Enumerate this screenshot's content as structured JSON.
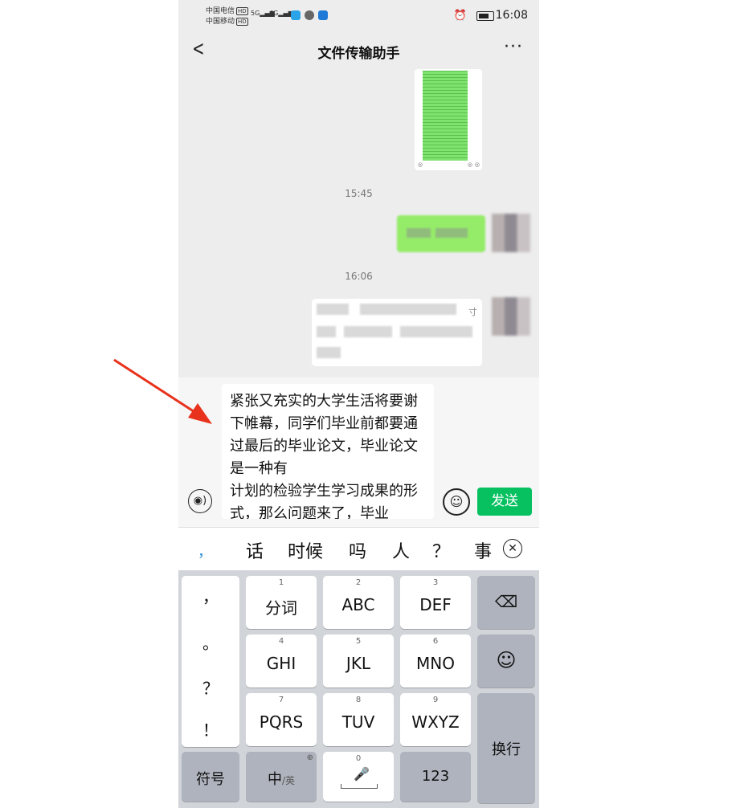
{
  "status_bar": {
    "carrier1": "中国电信",
    "carrier2": "中国移动",
    "hd": "HD",
    "net1": "5G",
    "net2": "4G",
    "time": "16:08"
  },
  "nav": {
    "title": "文件传输助手"
  },
  "chat": {
    "timestamps": [
      "15:45",
      "16:06"
    ],
    "card_glyph": "寸"
  },
  "input": {
    "text": "紧张又充实的大学生活将要谢下帷幕，同学们毕业前都要通过最后的毕业论文，毕业论文是一种有\n计划的检验学生学习成果的形式，那么问题来了，毕业",
    "send_label": "发送"
  },
  "candidates": {
    "comma": "，",
    "items": [
      "话",
      "时候",
      "吗",
      "人",
      "？",
      "事"
    ]
  },
  "keyboard": {
    "punct": [
      "，",
      "。",
      "？",
      "！"
    ],
    "keys": [
      {
        "num": "1",
        "label": "分词"
      },
      {
        "num": "2",
        "label": "ABC"
      },
      {
        "num": "3",
        "label": "DEF"
      },
      {
        "num": "4",
        "label": "GHI"
      },
      {
        "num": "5",
        "label": "JKL"
      },
      {
        "num": "6",
        "label": "MNO"
      },
      {
        "num": "7",
        "label": "PQRS"
      },
      {
        "num": "8",
        "label": "TUV"
      },
      {
        "num": "9",
        "label": "WXYZ"
      }
    ],
    "symbol_label": "符号",
    "lang_main": "中",
    "lang_sub": "/英",
    "space_num": "0",
    "num_label": "123",
    "enter_label": "换行"
  },
  "colors": {
    "accent_green": "#07c160",
    "bubble_green": "#95ec69"
  }
}
